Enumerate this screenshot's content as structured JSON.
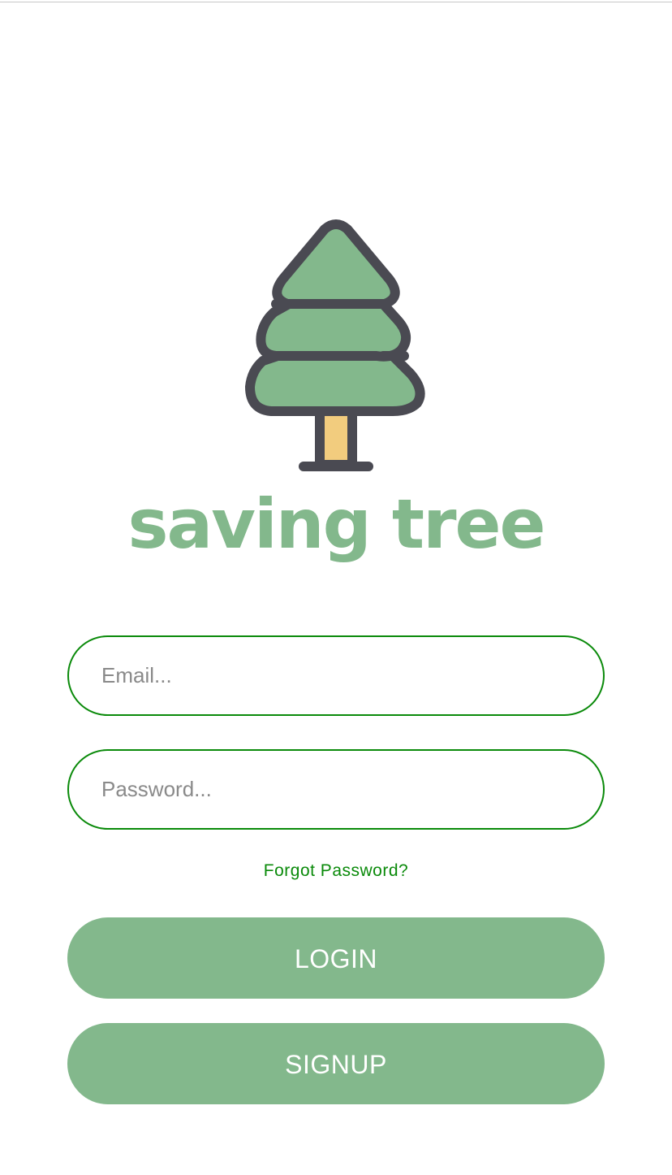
{
  "app": {
    "title": "saving tree",
    "logo_icon": "pine-tree-icon"
  },
  "colors": {
    "brand_green": "#83b88c",
    "accent_green": "#0a8a0a",
    "outline": "#4a4a52",
    "trunk": "#f2cc7e"
  },
  "login_form": {
    "email_placeholder": "Email...",
    "email_value": "",
    "password_placeholder": "Password...",
    "password_value": "",
    "forgot_password_label": "Forgot Password?",
    "login_label": "LOGIN",
    "signup_label": "SIGNUP"
  }
}
